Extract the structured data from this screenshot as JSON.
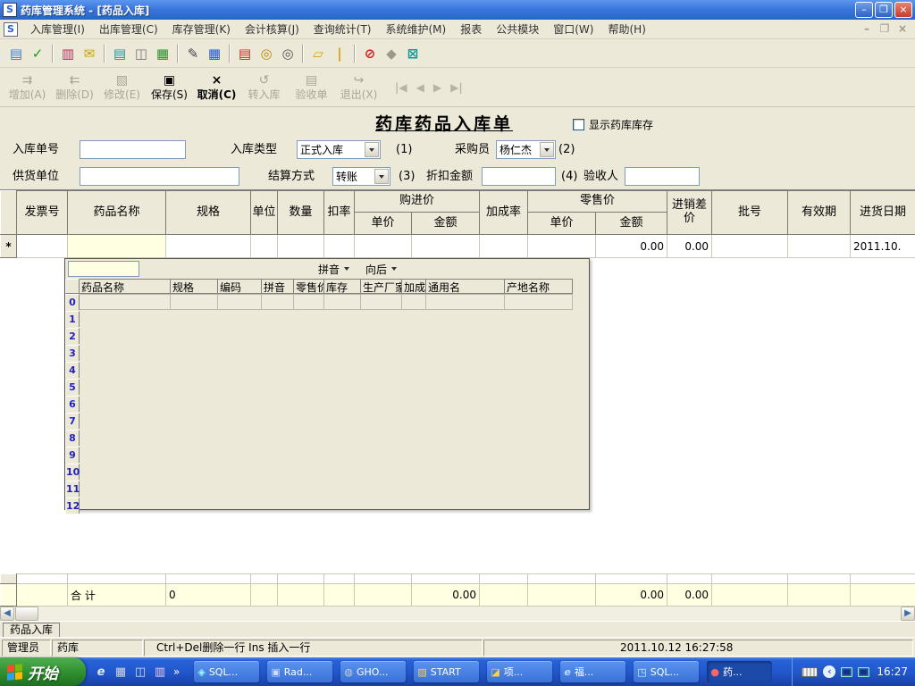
{
  "window": {
    "title": "药库管理系统 - [药品入库]",
    "controls": {
      "minimize": "–",
      "restore": "❐",
      "close": "×"
    }
  },
  "menubar": {
    "items": [
      "入库管理(I)",
      "出库管理(C)",
      "库存管理(K)",
      "会计核算(J)",
      "查询统计(T)",
      "系统维护(M)",
      "报表",
      "公共模块",
      "窗口(W)",
      "帮助(H)"
    ]
  },
  "toolbar_icons": [
    {
      "name": "entry-sheet-icon",
      "glyph": "▤",
      "style": "color:#3a7bd5"
    },
    {
      "name": "verify-sheet-icon",
      "glyph": "✓",
      "style": "color:#1a9c1a;font-weight:bold"
    },
    {
      "name": "separator-icon",
      "glyph": "",
      "style": "width:0;height:22px;border-left:1px solid #aca899;border-right:1px solid #fff;margin:0 4px"
    },
    {
      "name": "clipboard-out-icon",
      "glyph": "▥",
      "style": "color:#b03060"
    },
    {
      "name": "envelope-check-icon",
      "glyph": "✉",
      "style": "color:#c8a400"
    },
    {
      "name": "separator-icon",
      "glyph": "",
      "style": "width:0;height:22px;border-left:1px solid #aca899;border-right:1px solid #fff;margin:0 4px"
    },
    {
      "name": "clipboard-icon",
      "glyph": "▤",
      "style": "color:#0a9a9a"
    },
    {
      "name": "table-edit-icon",
      "glyph": "◫",
      "style": "color:#777"
    },
    {
      "name": "calculator-icon",
      "glyph": "▦",
      "style": "color:#2a8f2a"
    },
    {
      "name": "separator-icon",
      "glyph": "",
      "style": "width:0;height:22px;border-left:1px solid #aca899;border-right:1px solid #fff;margin:0 4px"
    },
    {
      "name": "write-note-icon",
      "glyph": "✎",
      "style": "color:#445"
    },
    {
      "name": "table-grid-icon",
      "glyph": "▦",
      "style": "color:#2255cc"
    },
    {
      "name": "separator-icon",
      "glyph": "",
      "style": "width:0;height:22px;border-left:1px solid #aca899;border-right:1px solid #fff;margin:0 4px"
    },
    {
      "name": "clipboard-cross-icon",
      "glyph": "▤",
      "style": "color:#cc2222"
    },
    {
      "name": "search-money-icon",
      "glyph": "◎",
      "style": "color:#b8860b"
    },
    {
      "name": "search-icon",
      "glyph": "◎",
      "style": "color:#555"
    },
    {
      "name": "separator-icon",
      "glyph": "",
      "style": "width:0;height:22px;border-left:1px solid #aca899;border-right:1px solid #fff;margin:0 4px"
    },
    {
      "name": "folder-open-icon",
      "glyph": "▱",
      "style": "color:#d4a017;font-weight:bold"
    },
    {
      "name": "thermometer-icon",
      "glyph": "|",
      "style": "color:#d4a017;font-weight:bold"
    },
    {
      "name": "separator-icon",
      "glyph": "",
      "style": "width:0;height:22px;border-left:1px solid #aca899;border-right:1px solid #fff;margin:0 4px"
    },
    {
      "name": "forbidden-icon",
      "glyph": "⊘",
      "style": "color:#cc2222;font-weight:bold"
    },
    {
      "name": "stamp-icon",
      "glyph": "◆",
      "style": "color:#9a9a8a"
    },
    {
      "name": "close-grid-icon",
      "glyph": "⊠",
      "style": "color:#0a9a9a;font-weight:bold"
    }
  ],
  "action_bar": {
    "buttons": [
      {
        "name": "add-button",
        "label": "增加(A)",
        "glyph": "⇉",
        "style": "color:#a9a695"
      },
      {
        "name": "delete-button",
        "label": "删除(D)",
        "glyph": "⇇",
        "style": "color:#a9a695"
      },
      {
        "name": "modify-button",
        "label": "修改(E)",
        "glyph": "▧",
        "style": "color:#a9a695"
      },
      {
        "name": "save-button",
        "label": "保存(S)",
        "glyph": "▣",
        "style": "color:#000"
      },
      {
        "name": "cancel-button",
        "label": "取消(C)",
        "glyph": "×",
        "style": "color:#000;font-weight:bold"
      },
      {
        "name": "transfer-button",
        "label": "转入库",
        "glyph": "↺",
        "style": "color:#a9a695"
      },
      {
        "name": "receipt-button",
        "label": "验收单",
        "glyph": "▤",
        "style": "color:#a9a695"
      },
      {
        "name": "exit-button",
        "label": "退出(X)",
        "glyph": "↪",
        "style": "color:#a9a695"
      }
    ],
    "nav": [
      "|◀",
      "◀",
      "▶",
      "▶|"
    ]
  },
  "form": {
    "title": "药库药品入库单",
    "show_stock": "显示药库库存",
    "order_no_label": "入库单号",
    "order_no_value": "",
    "type_label": "入库类型",
    "type_value": "正式入库",
    "type_hint": "(1)",
    "buyer_label": "采购员",
    "buyer_value": "杨仁杰",
    "buyer_hint": "(2)",
    "supplier_label": "供货单位",
    "supplier_value": "",
    "settle_label": "结算方式",
    "settle_value": "转账",
    "settle_hint": "(3)",
    "discount_label": "折扣金额",
    "discount_value": "",
    "discount_hint": "(4)",
    "inspector_label": "验收人",
    "inspector_value": ""
  },
  "grid": {
    "columns": {
      "invoice": "发票号",
      "drug": "药品名称",
      "spec": "规格",
      "unit": "单位",
      "qty": "数量",
      "discount": "扣率",
      "purchase": "购进价",
      "unit_price": "单价",
      "amount": "金额",
      "markup": "加成率",
      "retail": "零售价",
      "unit_price2": "单价",
      "amount2": "金额",
      "diff": "进销差价",
      "batch": "批号",
      "expiry": "有效期",
      "date": "进货日期"
    },
    "entry_row": {
      "marker": "*",
      "retail_amount": "0.00",
      "price_diff": "0.00",
      "purchase_date": "2011.10."
    },
    "total_row": {
      "label": "合  计",
      "qty": "0",
      "purchase_amount": "0.00",
      "retail_amount": "0.00",
      "price_diff": "0.00"
    }
  },
  "lookup": {
    "search_value": "",
    "search_mode": "拼音",
    "search_direction": "向后",
    "columns": [
      {
        "label": "药品名称",
        "style": "width:102px"
      },
      {
        "label": "规格",
        "style": "width:53px"
      },
      {
        "label": "编码",
        "style": "width:49px"
      },
      {
        "label": "拼音",
        "style": "width:36px"
      },
      {
        "label": "零售价",
        "style": "width:34px"
      },
      {
        "label": "库存",
        "style": "width:41px"
      },
      {
        "label": "生产厂家",
        "style": "width:46px"
      },
      {
        "label": "加成",
        "style": "width:27px"
      },
      {
        "label": "通用名",
        "style": "width:88px"
      },
      {
        "label": "产地名称",
        "style": "width:76px"
      }
    ],
    "row_numbers": [
      "0",
      "1",
      "2",
      "3",
      "4",
      "5",
      "6",
      "7",
      "8",
      "9",
      "10",
      "11",
      "12"
    ]
  },
  "tabstrip": {
    "active_tab": "药品入库"
  },
  "statusbar": {
    "user": "管理员",
    "store": "药库",
    "hint": "Ctrl+Del删除一行   Ins 插入一行",
    "datetime": "2011.10.12 16:27:58"
  },
  "taskbar": {
    "start_label": "开始",
    "quick_launch": [
      {
        "name": "ie-icon",
        "glyph": "e",
        "style": "color:#dceaff;font-style:italic;font-weight:bold"
      },
      {
        "name": "media-icon",
        "glyph": "▦",
        "style": "color:#cfd8e8"
      },
      {
        "name": "ie-doc-icon",
        "glyph": "◫",
        "style": "color:#cfe0ff"
      },
      {
        "name": "archive-icon",
        "glyph": "▥",
        "style": "color:#e8c8f0"
      }
    ],
    "more_chevron": "»",
    "buttons": [
      {
        "label": "SQL...",
        "glyph": "◈",
        "style": "color:#9fe"
      },
      {
        "label": "Rad...",
        "glyph": "▣",
        "style": "color:#cdf"
      },
      {
        "label": "GHO...",
        "glyph": "◍",
        "style": "color:#ccc"
      },
      {
        "label": "START",
        "glyph": "▨",
        "style": "color:#ffd23f"
      },
      {
        "label": "项...",
        "glyph": "◪",
        "style": "color:#ffd23f"
      },
      {
        "label": "福...",
        "glyph": "e",
        "style": "color:#bdf;font-style:italic;font-weight:bold"
      },
      {
        "label": "SQL...",
        "glyph": "◳",
        "style": "color:#cfe"
      },
      {
        "label": "药...",
        "glyph": "●",
        "style": "color:#f66",
        "active": "active"
      }
    ],
    "tray_chevron": "‹",
    "clock": "16:27"
  },
  "colors": {
    "titlebar_blue": "#2a65c8",
    "panel_beige": "#ece9d8",
    "highlight_yellow": "#ffffe1",
    "taskbar_blue": "#2257cd",
    "start_green": "#2f8f2f",
    "row_number_blue": "#2222bb"
  }
}
